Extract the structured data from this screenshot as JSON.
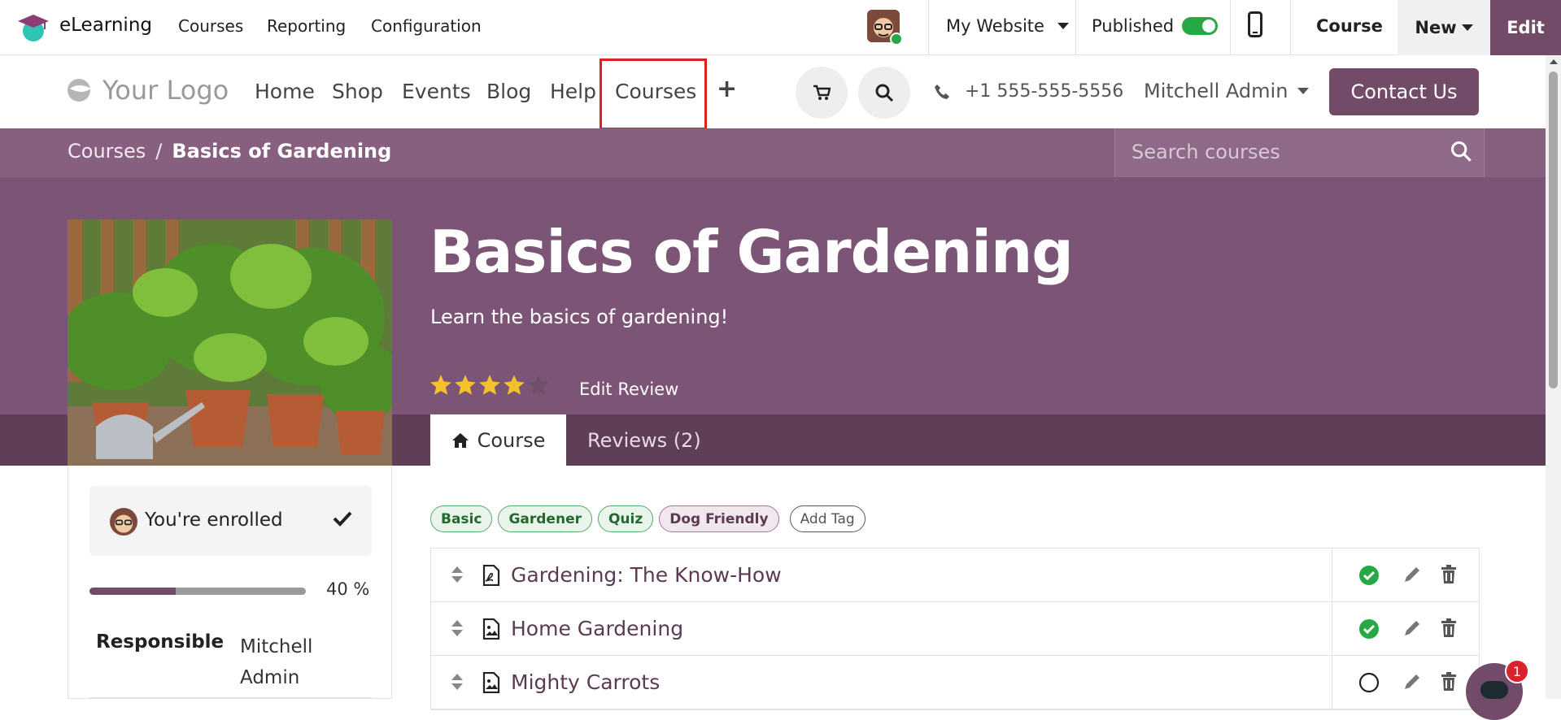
{
  "topbar": {
    "app_name": "eLearning",
    "menus": [
      "Courses",
      "Reporting",
      "Configuration"
    ],
    "website_selector": "My Website",
    "published_label": "Published",
    "course_label": "Course",
    "new_label": "New",
    "edit_label": "Edit"
  },
  "site_header": {
    "logo_text": "Your Logo",
    "nav": [
      "Home",
      "Shop",
      "Events",
      "Blog",
      "Help",
      "Courses"
    ],
    "add_label": "+",
    "phone": "+1 555-555-5556",
    "user": "Mitchell Admin",
    "contact_label": "Contact Us"
  },
  "breadcrumb": {
    "root": "Courses",
    "separator": "/",
    "current": "Basics of Gardening",
    "search_placeholder": "Search courses"
  },
  "hero": {
    "title": "Basics of Gardening",
    "subtitle": "Learn the basics of gardening!",
    "rating": 4,
    "rating_max": 5,
    "edit_review": "Edit Review"
  },
  "tabs": {
    "course": "Course",
    "reviews": "Reviews (2)"
  },
  "sidebar": {
    "enrolled_text": "You're enrolled",
    "progress_percent": 40,
    "progress_label": "40 %",
    "responsible_label": "Responsible",
    "responsible_value": "Mitchell Admin"
  },
  "tags": [
    {
      "label": "Basic",
      "style": "green"
    },
    {
      "label": "Gardener",
      "style": "green"
    },
    {
      "label": "Quiz",
      "style": "green"
    },
    {
      "label": "Dog Friendly",
      "style": "purple"
    }
  ],
  "add_tag_label": "Add Tag",
  "lessons": [
    {
      "name": "Gardening: The Know-How",
      "type": "pdf-icon",
      "done": true
    },
    {
      "name": "Home Gardening",
      "type": "image-icon",
      "done": true
    },
    {
      "name": "Mighty Carrots",
      "type": "image-icon",
      "done": false
    }
  ],
  "notifications": {
    "count": "1"
  },
  "colors": {
    "brand": "#714b67",
    "success": "#28a745",
    "highlight": "#e02020"
  }
}
